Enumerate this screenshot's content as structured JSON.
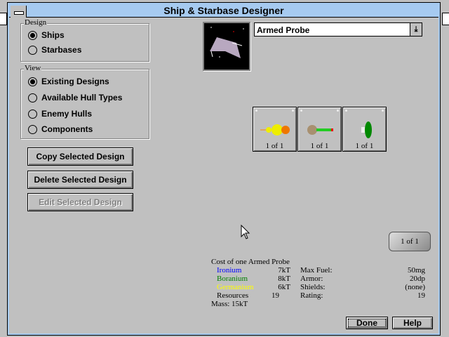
{
  "window": {
    "title": "Ship & Starbase Designer"
  },
  "design_group": {
    "label": "Design",
    "options": [
      {
        "label": "Ships",
        "selected": true
      },
      {
        "label": "Starbases",
        "selected": false
      }
    ]
  },
  "view_group": {
    "label": "View",
    "options": [
      {
        "label": "Existing Designs",
        "selected": true
      },
      {
        "label": "Available Hull Types",
        "selected": false
      },
      {
        "label": "Enemy Hulls",
        "selected": false
      },
      {
        "label": "Components",
        "selected": false
      }
    ]
  },
  "buttons": {
    "copy": "Copy Selected Design",
    "delete": "Delete Selected Design",
    "edit": "Edit Selected Design",
    "done": "Done",
    "help": "Help"
  },
  "design_select": {
    "value": "Armed Probe"
  },
  "slots": [
    {
      "count": "1 of 1"
    },
    {
      "count": "1 of 1"
    },
    {
      "count": "1 of 1"
    }
  ],
  "hull_counter": "1 of 1",
  "cost": {
    "title": "Cost of one Armed Probe",
    "minerals": [
      {
        "name": "Ironium",
        "value": "7kT",
        "color": "#0000ff"
      },
      {
        "name": "Boranium",
        "value": "8kT",
        "color": "#008000"
      },
      {
        "name": "Germanium",
        "value": "6kT",
        "color": "#ffff00"
      }
    ],
    "resources_label": "Resources",
    "resources": "19",
    "mass": "Mass: 15kT"
  },
  "specs": [
    {
      "label": "Max Fuel:",
      "value": "50mg"
    },
    {
      "label": "Armor:",
      "value": "20dp"
    },
    {
      "label": "Shields:",
      "value": "(none)"
    },
    {
      "label": "Rating:",
      "value": "19"
    }
  ]
}
